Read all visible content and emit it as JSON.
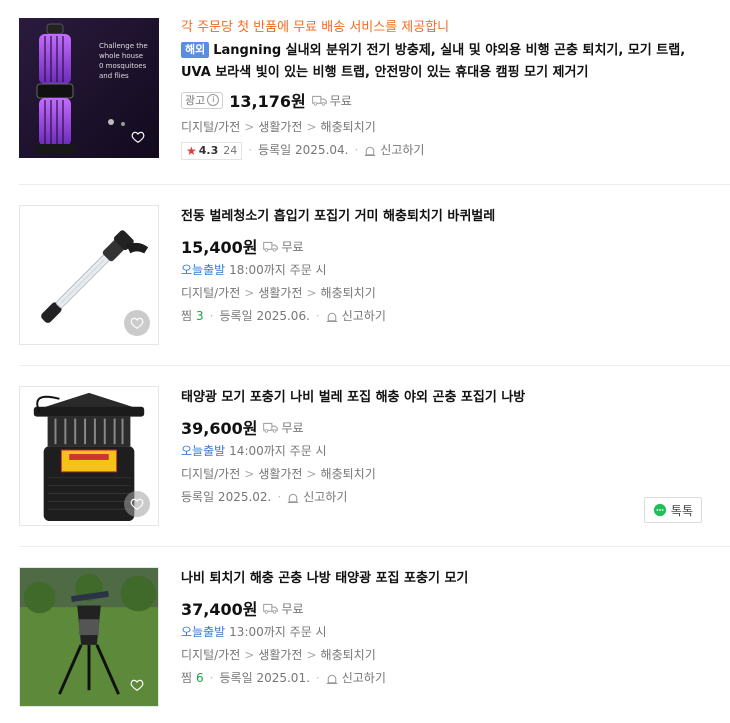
{
  "items": [
    {
      "promo": "각 주문당 첫 반품에 무료 배송 서비스를 제공합니",
      "tag": "해외",
      "title": "Langning 실내외 분위기 전기 방충제, 실내 및 야외용 비행 곤충 퇴치기, 모기 트랩, UVA 보라색 빛이 있는 비행 트랩, 안전망이 있는 휴대용 캠핑 모기 제거기",
      "ad_label": "광고",
      "price": "13,176원",
      "shipping": "무료",
      "category": [
        "디지털/가전",
        "생활가전",
        "해충퇴치기"
      ],
      "rating": "4.3",
      "review_count": "24",
      "registered": "등록일 2025.04.",
      "report": "신고하기",
      "image_text": [
        "Challenge the",
        "whole house",
        "0 mosquitoes",
        "and flies"
      ]
    },
    {
      "title": "전동 벌레청소기 흡입기 포집기 거미 해충퇴치기 바퀴벌레",
      "price": "15,400원",
      "shipping": "무료",
      "delivery_badge": "오늘출발",
      "delivery_text": "18:00까지 주문 시",
      "category": [
        "디지털/가전",
        "생활가전",
        "해충퇴치기"
      ],
      "zzim_label": "찜",
      "zzim_count": "3",
      "registered": "등록일 2025.06.",
      "report": "신고하기"
    },
    {
      "title": "태양광 모기 포충기 나비 벌레 포집 해충 야외 곤충 포집기 나방",
      "price": "39,600원",
      "shipping": "무료",
      "delivery_badge": "오늘출발",
      "delivery_text": "14:00까지 주문 시",
      "category": [
        "디지털/가전",
        "생활가전",
        "해충퇴치기"
      ],
      "registered": "등록일 2025.02.",
      "report": "신고하기",
      "talk": "톡톡"
    },
    {
      "title": "나비 퇴치기 해충 곤충 나방 태양광 포집 포충기 모기",
      "price": "37,400원",
      "shipping": "무료",
      "delivery_badge": "오늘출발",
      "delivery_text": "13:00까지 주문 시",
      "category": [
        "디지털/가전",
        "생활가전",
        "해충퇴치기"
      ],
      "zzim_label": "찜",
      "zzim_count": "6",
      "registered": "등록일 2025.01.",
      "report": "신고하기"
    }
  ],
  "colors": {
    "promo": "#f36c21",
    "tag_bg": "#5a8ee6",
    "delivery": "#3a7bd5",
    "zzim": "#17a34a",
    "star": "#e33a3a"
  }
}
